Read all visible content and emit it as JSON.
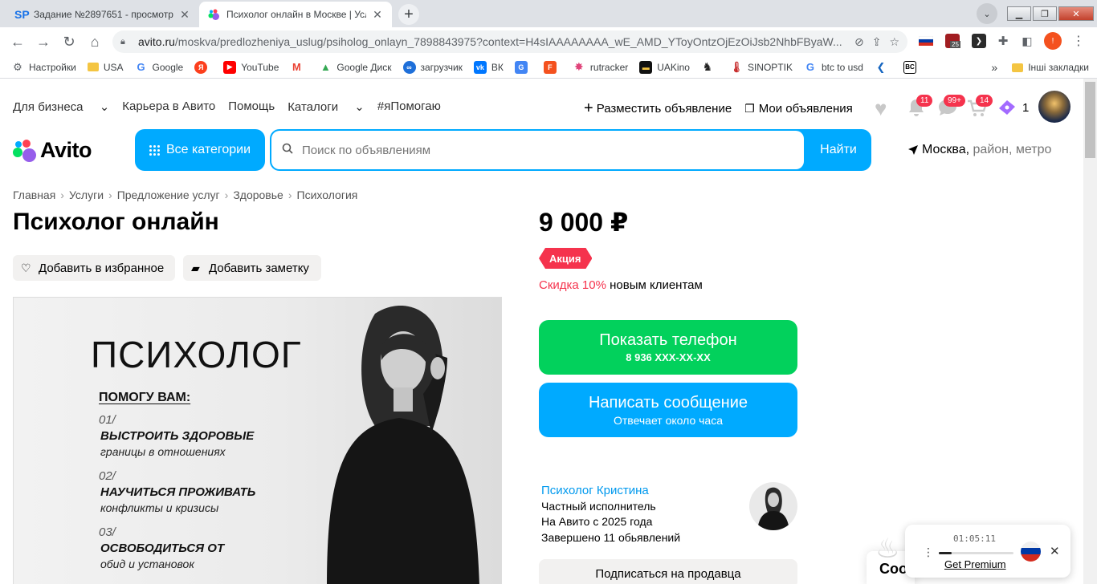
{
  "browser": {
    "tabs": [
      {
        "title": "Задание №2897651 - просмотр",
        "active": false
      },
      {
        "title": "Психолог онлайн в Москве | Усл",
        "active": true
      }
    ],
    "url_host": "avito.ru",
    "url_path": "/moskva/predlozheniya_uslug/psiholog_onlayn_7898843975?context=H4sIAAAAAAAA_wE_AMD_YToyOntzOjEzOiJsb2NhbFByaW...",
    "extension_badge": "25",
    "bookmarks": [
      "Настройки",
      "USA",
      "Google",
      "YouTube",
      "Google Диск",
      "загрузчик",
      "ВК",
      "rutracker",
      "UAKino",
      "SINOPTIK",
      "btc to usd"
    ],
    "other_bookmarks": "Інші закладки",
    "overflow": "»"
  },
  "site": {
    "topnav": [
      "Для бизнеса",
      "Карьера в Авито",
      "Помощь",
      "Каталоги",
      "#яПомогаю"
    ],
    "post_ad": "Разместить объявление",
    "my_ads": "Мои объявления",
    "badges": {
      "notifications": "11",
      "messages": "99+",
      "cart": "14"
    },
    "promo_count": "1",
    "logo": "Avito",
    "all_categories": "Все категории",
    "search_placeholder": "Поиск по объявлениям",
    "find": "Найти",
    "location_city": "Москва,",
    "location_rest": " район, метро"
  },
  "listing": {
    "breadcrumbs": [
      "Главная",
      "Услуги",
      "Предложение услуг",
      "Здоровье",
      "Психология"
    ],
    "title": "Психолог онлайн",
    "add_favorite": "Добавить в избранное",
    "add_note": "Добавить заметку",
    "price": "9 000 ₽",
    "promo_label": "Акция",
    "discount_red": "Скидка 10%",
    "discount_rest": " новым клиентам",
    "show_phone": "Показать телефон",
    "phone_masked": "8 936 XXX-XX-XX",
    "write_message": "Написать сообщение",
    "reply_time": "Отвечает около часа",
    "seller": {
      "name": "Психолог Кристина",
      "type": "Частный исполнитель",
      "since": "На Авито с 2025 года",
      "completed": "Завершено 11 обьявлений"
    },
    "subscribe": "Подписаться на продавца"
  },
  "photo": {
    "title": "ПСИХОЛОГ",
    "help": "ПОМОГУ ВАМ:",
    "items": [
      {
        "num": "01/",
        "line1": "ВЫСТРОИТЬ ЗДОРОВЫЕ",
        "line2": "границы в отношениях"
      },
      {
        "num": "02/",
        "line1": "НАУЧИТЬСЯ ПРОЖИВАТЬ",
        "line2": "конфликты и кризисы"
      },
      {
        "num": "03/",
        "line1": "ОСВОБОДИТЬСЯ ОТ",
        "line2": "обид и установок"
      }
    ]
  },
  "widgets": {
    "cookie_partial": "Coo",
    "player_time": "01:05:11",
    "player_progress": 0.17,
    "get_premium": "Get Premium"
  }
}
